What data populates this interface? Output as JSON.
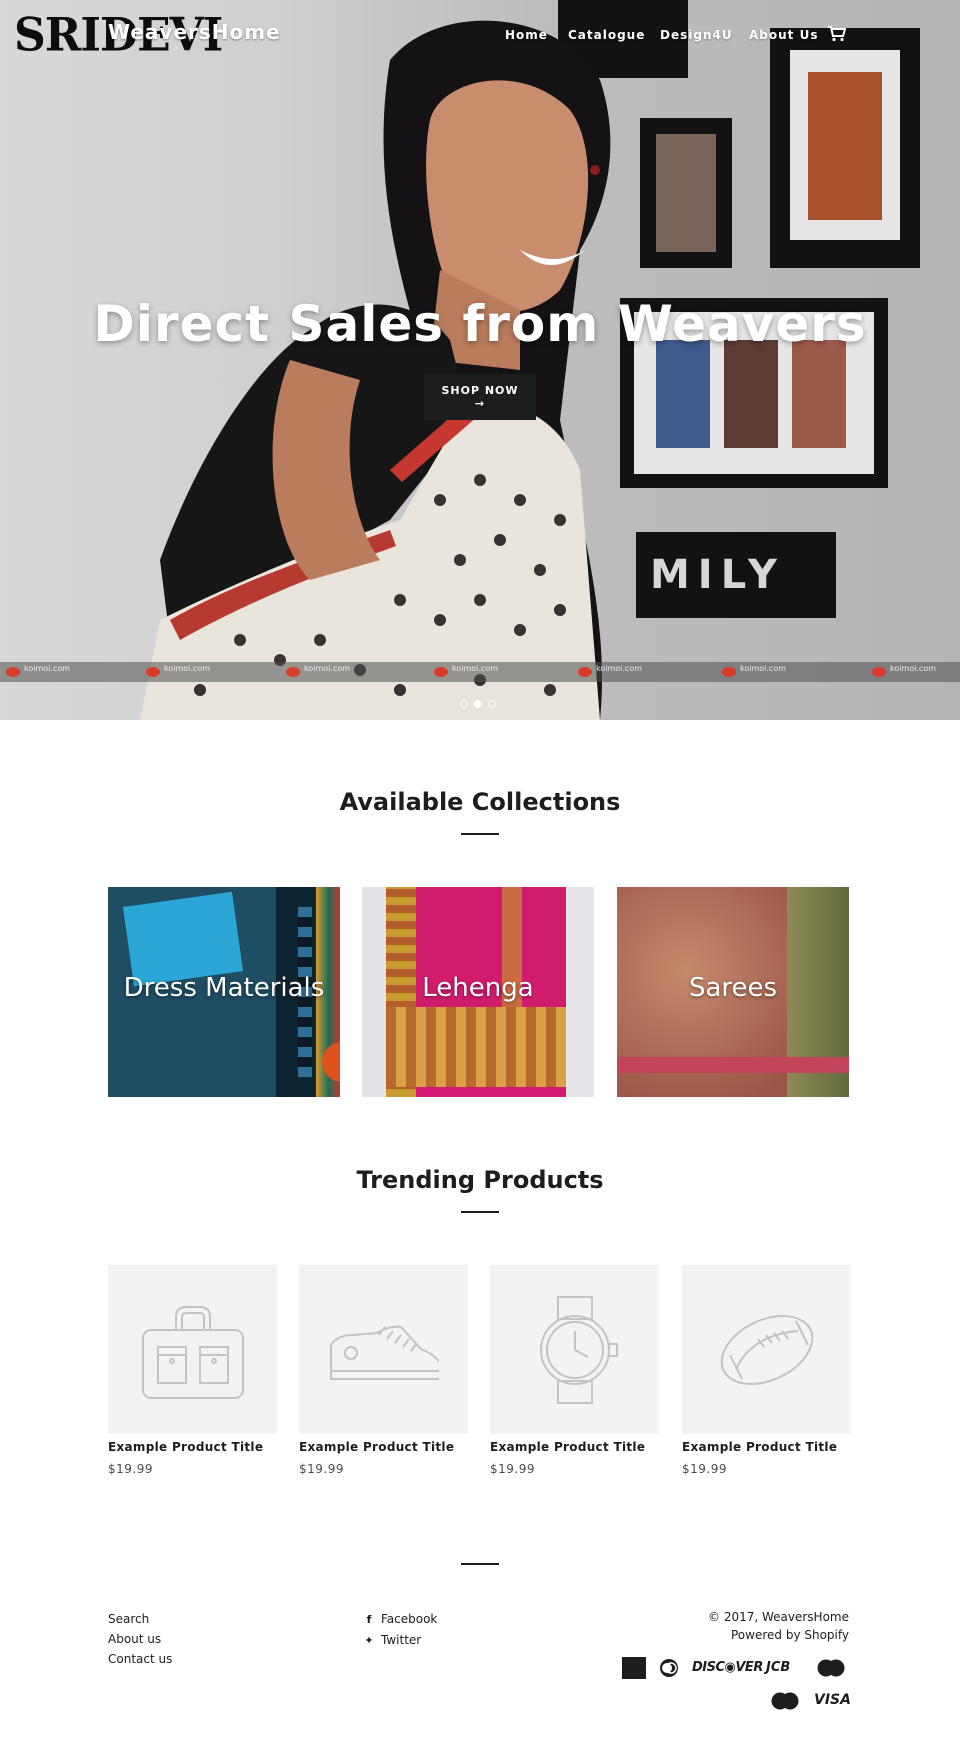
{
  "header": {
    "logo_text": "SRIDEVI",
    "store_name": "WeaversHome",
    "nav": [
      "Home",
      "Catalogue",
      "Design4U",
      "About Us"
    ],
    "cart_icon": "cart-icon"
  },
  "hero": {
    "title": "Direct Sales from Weavers",
    "button_label": "SHOP NOW",
    "button_arrow": "→",
    "watermark": "koimoi.com",
    "slides": 3,
    "active_slide": 2
  },
  "collections": {
    "heading": "Available Collections",
    "items": [
      {
        "label": "Dress Materials",
        "color": "#1f4d63"
      },
      {
        "label": "Lehenga",
        "color": "#c91a6e"
      },
      {
        "label": "Sarees",
        "color": "#b06a55"
      }
    ]
  },
  "trending": {
    "heading": "Trending Products",
    "items": [
      {
        "title": "Example Product Title",
        "price": "$19.99",
        "icon": "bag-icon"
      },
      {
        "title": "Example Product Title",
        "price": "$19.99",
        "icon": "shoe-icon"
      },
      {
        "title": "Example Product Title",
        "price": "$19.99",
        "icon": "watch-icon"
      },
      {
        "title": "Example Product Title",
        "price": "$19.99",
        "icon": "football-icon"
      }
    ]
  },
  "footer": {
    "links": [
      "Search",
      "About us",
      "Contact us"
    ],
    "social": [
      {
        "label": "Facebook",
        "icon": "facebook-icon"
      },
      {
        "label": "Twitter",
        "icon": "twitter-icon"
      }
    ],
    "copyright": "© 2017, WeaversHome",
    "powered": "Powered by Shopify",
    "payments": [
      "AMERICAN EXPRESS",
      "Diners",
      "DISCOVER",
      "JCB",
      "Maestro",
      "MasterCard",
      "VISA"
    ]
  }
}
